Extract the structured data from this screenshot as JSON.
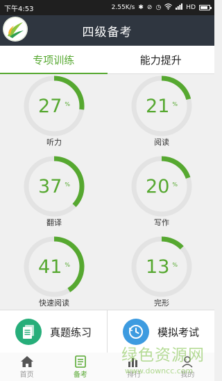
{
  "status_bar": {
    "time": "下午4:53",
    "speed": "2.55K/s",
    "network": "HD",
    "icons": [
      "bluetooth-icon",
      "mute-icon",
      "alarm-icon",
      "wifi-icon",
      "signal-icon",
      "battery-icon"
    ]
  },
  "header": {
    "title": "四级备考"
  },
  "tabs": [
    {
      "label": "专项训练",
      "active": true
    },
    {
      "label": "能力提升",
      "active": false
    }
  ],
  "skills": [
    {
      "label": "听力",
      "percent": 27,
      "percent_sign": "%"
    },
    {
      "label": "阅读",
      "percent": 21,
      "percent_sign": "%"
    },
    {
      "label": "翻译",
      "percent": 37,
      "percent_sign": "%"
    },
    {
      "label": "写作",
      "percent": 20,
      "percent_sign": "%"
    },
    {
      "label": "快速阅读",
      "percent": 41,
      "percent_sign": "%"
    },
    {
      "label": "完形",
      "percent": 13,
      "percent_sign": "%"
    }
  ],
  "practice": {
    "real_exam": {
      "label": "真题练习",
      "color": "#27ae7a"
    },
    "mock_exam": {
      "label": "模拟考试",
      "color": "#3d9be0"
    }
  },
  "bottom_nav": [
    {
      "label": "首页",
      "icon": "home-icon",
      "active": false
    },
    {
      "label": "备考",
      "icon": "document-icon",
      "active": true
    },
    {
      "label": "排行",
      "icon": "bar-chart-icon",
      "active": false
    },
    {
      "label": "我的",
      "icon": "user-icon",
      "active": false
    }
  ],
  "watermark": {
    "title": "绿色资源网",
    "url": "www.downcc.com"
  },
  "colors": {
    "accent": "#56a830",
    "ring_track": "#e3e3e3",
    "header_bg": "#2f3640"
  }
}
